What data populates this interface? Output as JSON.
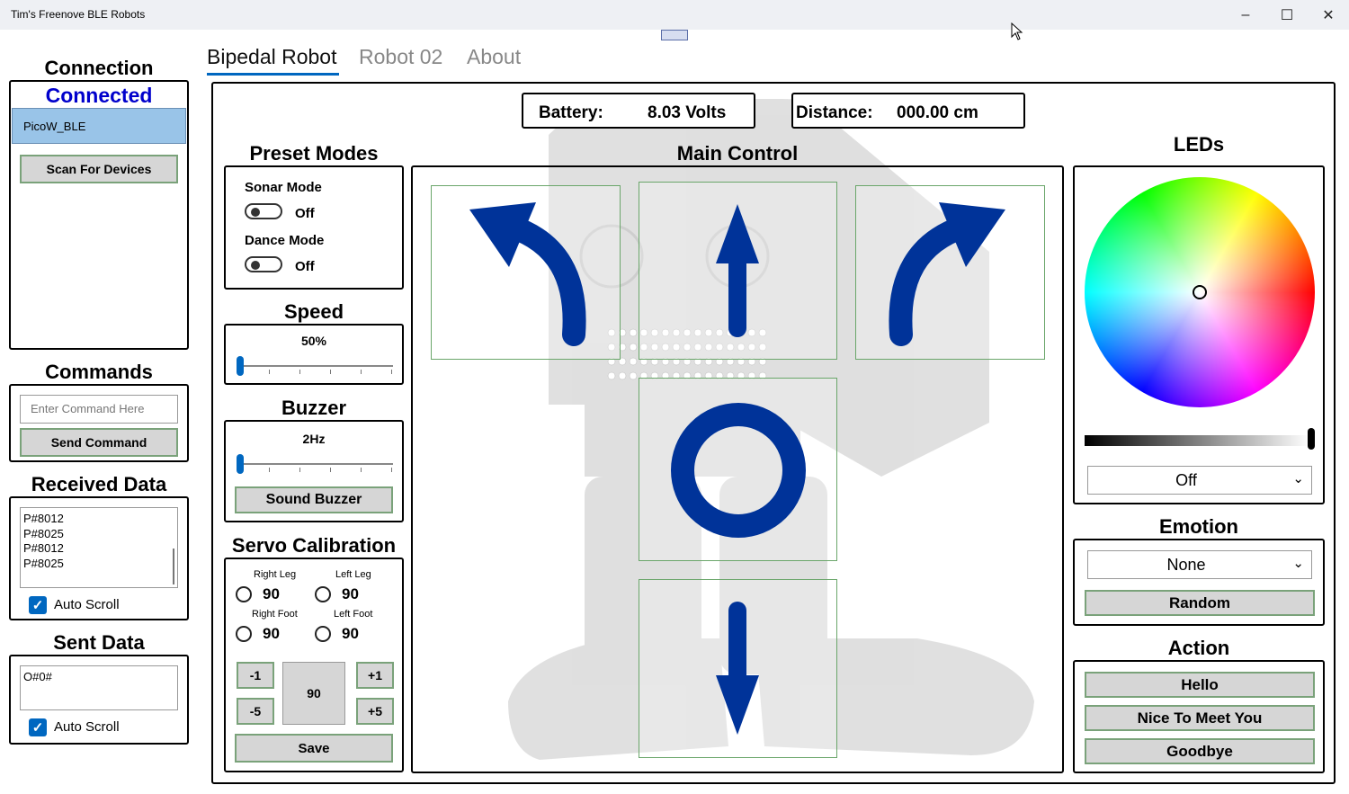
{
  "window": {
    "title": "Tim's Freenove BLE Robots"
  },
  "tabs": [
    {
      "label": "Bipedal Robot"
    },
    {
      "label": "Robot 02"
    },
    {
      "label": "About"
    }
  ],
  "connection": {
    "heading": "Connection",
    "status": "Connected",
    "device": "PicoW_BLE",
    "scan_label": "Scan For Devices"
  },
  "commands": {
    "heading": "Commands",
    "placeholder": "Enter Command Here",
    "send_label": "Send Command"
  },
  "received": {
    "heading": "Received Data",
    "lines": [
      "P#8012",
      "P#8025",
      "P#8012",
      "P#8025"
    ],
    "autoscroll_label": "Auto Scroll"
  },
  "sent": {
    "heading": "Sent Data",
    "text": "O#0#",
    "autoscroll_label": "Auto Scroll"
  },
  "status": {
    "battery_label": "Battery:",
    "battery_value": "8.03 Volts",
    "distance_label": "Distance:",
    "distance_value": "000.00 cm"
  },
  "preset": {
    "heading": "Preset Modes",
    "sonar_label": "Sonar Mode",
    "sonar_state": "Off",
    "dance_label": "Dance Mode",
    "dance_state": "Off"
  },
  "speed": {
    "heading": "Speed",
    "value_text": "50%",
    "level": 0
  },
  "buzzer": {
    "heading": "Buzzer",
    "value_text": "2Hz",
    "level": 0,
    "button_label": "Sound Buzzer"
  },
  "servo": {
    "heading": "Servo Calibration",
    "right_leg_label": "Right Leg",
    "right_leg_value": "90",
    "left_leg_label": "Left Leg",
    "left_leg_value": "90",
    "right_foot_label": "Right Foot",
    "right_foot_value": "90",
    "left_foot_label": "Left Foot",
    "left_foot_value": "90",
    "minus1": "-1",
    "minus5": "-5",
    "plus1": "+1",
    "plus5": "+5",
    "current_value": "90",
    "save_label": "Save"
  },
  "main_control": {
    "heading": "Main Control",
    "arrow_color": "#003399"
  },
  "leds": {
    "heading": "LEDs",
    "selected": "Off"
  },
  "emotion": {
    "heading": "Emotion",
    "selected": "None",
    "random_label": "Random"
  },
  "action": {
    "heading": "Action",
    "buttons": [
      "Hello",
      "Nice To Meet You",
      "Goodbye"
    ]
  },
  "colors": {
    "accent": "#0067c0",
    "connected": "#0000cc",
    "selection": "#99c4e8",
    "arrow": "#003399"
  }
}
